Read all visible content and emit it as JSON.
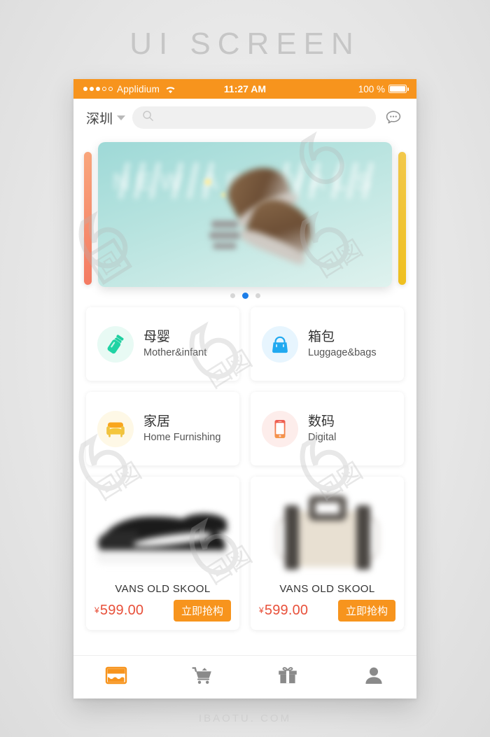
{
  "page": {
    "title": "UI SCREEN",
    "footer": "IBAOTU. COM",
    "watermark": "包图网"
  },
  "colors": {
    "brand_orange": "#F7941D",
    "price_red": "#E8503A",
    "dot_active_blue": "#1C7EE8",
    "mint_banner": "#9ED9D7"
  },
  "statusbar": {
    "carrier": "Applidium",
    "time": "11:27 AM",
    "battery_percent": "100 %",
    "signal_dots_filled": 3,
    "signal_dots_total": 5,
    "wifi_icon": "wifi-icon",
    "battery_icon": "battery-icon"
  },
  "header": {
    "city": "深圳",
    "city_caret_icon": "chevron-down-icon",
    "search_icon": "search-icon",
    "search_value": "",
    "search_placeholder": "",
    "chat_icon": "chat-bubble-icon"
  },
  "banner": {
    "ghost_text": "NEW ARRIVALS",
    "dots_total": 3,
    "dot_active_index": 1,
    "left_peek_color": "#F47B63",
    "right_peek_color": "#EFC01F"
  },
  "categories": [
    {
      "cn": "母婴",
      "en": "Mother&infant",
      "icon": "baby-bottle-icon",
      "icon_color": "#1FCFA0",
      "bg": "#E6F9F3"
    },
    {
      "cn": "箱包",
      "en": "Luggage&bags",
      "icon": "handbag-icon",
      "icon_color": "#20A9F0",
      "bg": "#E4F4FD"
    },
    {
      "cn": "家居",
      "en": "Home Furnishing",
      "icon": "armchair-icon",
      "icon_color": "#F4B722",
      "bg": "#FDF6E1"
    },
    {
      "cn": "数码",
      "en": "Digital",
      "icon": "smartphone-icon",
      "icon_color": "#F0604D",
      "bg": "#FDECEA"
    }
  ],
  "products": [
    {
      "name": "VANS OLD SKOOL",
      "currency": "¥",
      "price": "599.00",
      "buy_label": "立即抢构",
      "image": "black-sneaker-image"
    },
    {
      "name": "VANS OLD SKOOL",
      "currency": "¥",
      "price": "599.00",
      "buy_label": "立即抢构",
      "image": "beige-handbag-image"
    }
  ],
  "tabbar": [
    {
      "icon": "store-icon",
      "active": true
    },
    {
      "icon": "cart-icon",
      "active": false
    },
    {
      "icon": "gift-icon",
      "active": false
    },
    {
      "icon": "person-icon",
      "active": false
    }
  ]
}
